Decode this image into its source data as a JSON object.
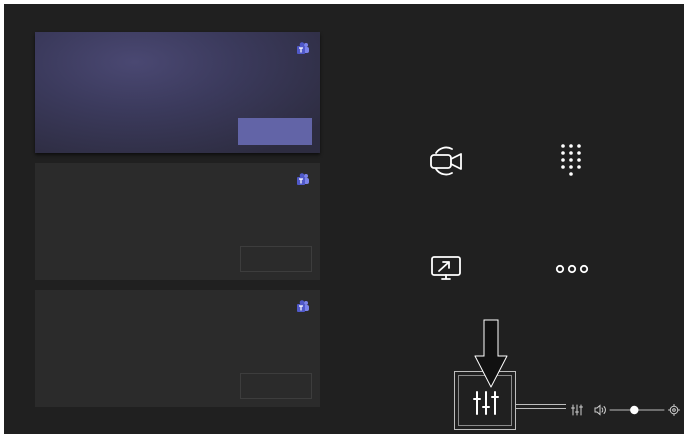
{
  "meeting_list": {
    "items": [
      {
        "state": "selected",
        "app_icon": "teams-icon",
        "action": "join-button"
      },
      {
        "state": "default",
        "app_icon": "teams-icon",
        "action": "join-button"
      },
      {
        "state": "default",
        "app_icon": "teams-icon",
        "action": "join-button"
      }
    ]
  },
  "controls": {
    "icons": [
      "meet-now-icon",
      "dial-pad-icon",
      "share-screen-icon",
      "more-options-icon"
    ]
  },
  "callout": {
    "target": "device-settings-button",
    "target_icon": "sliders-icon",
    "pointer": "down-arrow-icon"
  },
  "status_bar": {
    "icons": [
      "sliders-icon",
      "speaker-icon",
      "volume-slider",
      "gear-icon"
    ],
    "volume_level": 0.45
  },
  "colors": {
    "background": "#202020",
    "card": "#2b2b2b",
    "card_selected": "#3b3a5c",
    "accent": "#6264a7",
    "icon": "#ffffff"
  }
}
